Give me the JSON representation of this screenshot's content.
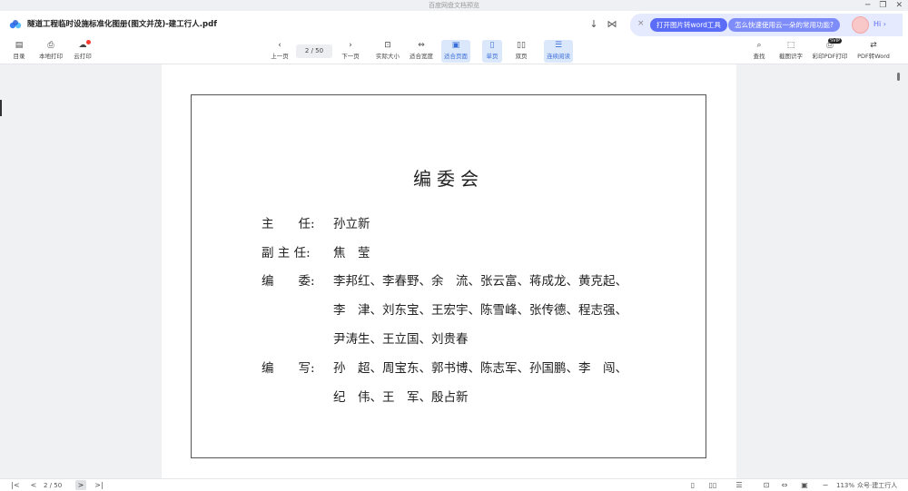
{
  "window": {
    "title": "百度网盘文档预览",
    "controls": [
      "─",
      "❐",
      "✕"
    ]
  },
  "header": {
    "doc_title": "隧道工程临时设施标准化图册(图文并茂)-建工行人.pdf",
    "download_icon": "↓",
    "share_icon": "⋈"
  },
  "promo": {
    "close": "×",
    "button1": "打开图片转word工具",
    "button2": "怎么快速使用云一朵的常用功能?",
    "greeting": "Hi ›"
  },
  "toolbar": {
    "left": [
      {
        "icon": "▤",
        "label": "目录"
      },
      {
        "icon": "⎙",
        "label": "本地打印"
      },
      {
        "icon": "☁",
        "label": "云打印"
      }
    ],
    "prev": {
      "icon": "‹",
      "label": "上一页"
    },
    "page_indicator": "2  / 50",
    "next": {
      "icon": "›",
      "label": "下一页"
    },
    "view": [
      {
        "icon": "⊡",
        "label": "实际大小"
      },
      {
        "icon": "⇔",
        "label": "适合宽度"
      },
      {
        "icon": "▣",
        "label": "适合页面"
      },
      {
        "icon": "▯",
        "label": "单页"
      },
      {
        "icon": "▯▯",
        "label": "双页"
      },
      {
        "icon": "☰",
        "label": "连续阅读"
      }
    ],
    "right": [
      {
        "icon": "⌕",
        "label": "查找"
      },
      {
        "icon": "⬚",
        "label": "截图识字"
      },
      {
        "icon": "⎙",
        "label": "彩印PDF打印"
      },
      {
        "icon": "⇄",
        "label": "PDF转Word"
      }
    ],
    "hot_badge": "SVIP"
  },
  "document": {
    "title": "编委会",
    "rows": [
      {
        "label": "主　　任:",
        "value": "孙立新"
      },
      {
        "label": "副 主 任:",
        "value": "焦　莹"
      },
      {
        "label": "编　　委:",
        "value": "李邦红、李春野、余　流、张云富、蒋成龙、黄克起、"
      },
      {
        "label": "",
        "value": "李　津、刘东宝、王宏宇、陈雪峰、张传德、程志强、"
      },
      {
        "label": "",
        "value": "尹涛生、王立国、刘贵春"
      },
      {
        "label": "编　　写:",
        "value": "孙　超、周宝东、郭书博、陈志军、孙国鹏、李　闯、"
      },
      {
        "label": "",
        "value": "纪　伟、王　军、殷占新"
      }
    ]
  },
  "statusbar": {
    "first": "|<",
    "prev": "<",
    "page": "2  / 50",
    "next": ">",
    "last": ">|",
    "view_icons": [
      "▯",
      "▯▯",
      "☰",
      "⊡",
      "⇔",
      "▣"
    ],
    "zoom_minus": "−",
    "zoom": "113%",
    "watermark": "众号·建工行人"
  }
}
